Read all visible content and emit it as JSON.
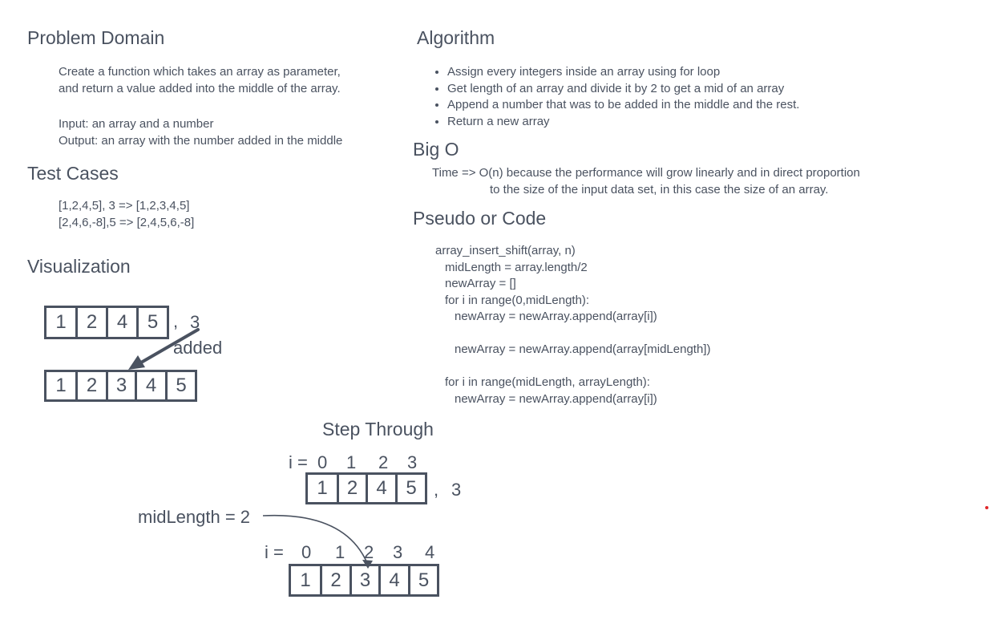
{
  "problem": {
    "heading": "Problem Domain",
    "desc": [
      "Create a function which takes an array as parameter,",
      "and return a value added into the middle of the array."
    ],
    "io": [
      "Input: an array and a number",
      "Output: an array with the number added in the middle"
    ]
  },
  "tests": {
    "heading": "Test Cases",
    "items": [
      "[1,2,4,5], 3 => [1,2,3,4,5]",
      "[2,4,6,-8],5 => [2,4,5,6,-8]"
    ]
  },
  "algorithm": {
    "heading": "Algorithm",
    "items": [
      "Assign every integers inside an array using for loop",
      "Get length of an array and divide it by 2 to get a mid of an array",
      "Append a number that was to be added in the middle and the rest.",
      "Return a new array"
    ]
  },
  "bigo": {
    "heading": "Big O",
    "lines": [
      "Time => O(n) because the performance will grow linearly and in direct proportion",
      "to the size of the input data set, in this case the size of an array."
    ]
  },
  "pseudo": {
    "heading": "Pseudo or Code",
    "lines": [
      "array_insert_shift(array, n)",
      "midLength = array.length/2",
      "newArray = []",
      "for i in range(0,midLength):",
      "newArray = newArray.append(array[i])",
      "",
      "newArray = newArray.append(array[midLength])",
      "",
      "for i in range(midLength, arrayLength):",
      "newArray = newArray.append(array[i])"
    ]
  },
  "visualization": {
    "heading": "Visualization",
    "input_array": [
      "1",
      "2",
      "4",
      "5"
    ],
    "comma": ",",
    "insert_value": "3",
    "added_label": "added",
    "result_array": [
      "1",
      "2",
      "3",
      "4",
      "5"
    ]
  },
  "step_through": {
    "heading": "Step Through",
    "top_index_label": "i =",
    "top_indices": [
      "0",
      "1",
      "2",
      "3"
    ],
    "input_array": [
      "1",
      "2",
      "4",
      "5"
    ],
    "comma": ",",
    "insert_value": "3",
    "mid_label": "midLength = 2",
    "bottom_index_label": "i =",
    "bottom_indices": [
      "0",
      "1",
      "2",
      "3",
      "4"
    ],
    "result_array": [
      "1",
      "2",
      "3",
      "4",
      "5"
    ]
  },
  "colors": {
    "ink": "#4a5260",
    "dot": "#e0262a",
    "background": "#ffffff"
  }
}
